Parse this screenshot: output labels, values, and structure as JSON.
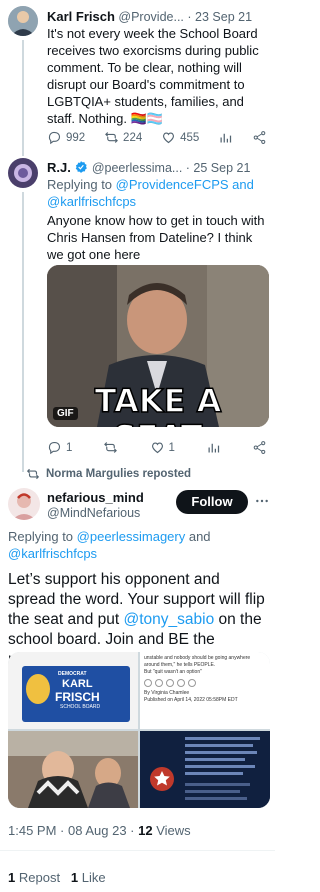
{
  "tweet1": {
    "name": "Karl Frisch",
    "handle": "@Provide...",
    "date": "· 23 Sep 21",
    "text": "It's not every week the School Board receives two exorcisms during public comment. To be clear, nothing will disrupt our Board's commitment to LGBTQIA+ students, families, and staff. Nothing. 🏳️‍🌈🏳️‍⚧️",
    "replies": "992",
    "retweets": "224",
    "likes": "455"
  },
  "tweet2": {
    "name": "R.J.",
    "handle": "@peerlessima...",
    "date": "· 25 Sep 21",
    "replying_prefix": "Replying to ",
    "replying_to_1": "@ProvidenceFCPS",
    "replying_and": " and",
    "replying_to_2": "@karlfrischfcps",
    "text": "Anyone know how to get in touch with Chris Hansen from Dateline? I think we got one here",
    "gif_caption": "TAKE A SEAT",
    "gif_badge": "GIF",
    "replies": "1",
    "likes": "1"
  },
  "repost": {
    "label": "Norma Margulies reposted"
  },
  "main": {
    "name": "nefarious_mind",
    "handle": "@MindNefarious",
    "follow_label": "Follow",
    "replying_prefix": "Replying to ",
    "replying_to_1": "@peerlessimagery",
    "replying_and": " and",
    "replying_to_2": "@karlfrischfcps",
    "text_before": "Let’s support his opponent and spread the word. Your support will flip the seat and put ",
    "mention": "@tony_sabio",
    "text_after": " on the school board. Join and BE the movement!",
    "collage": {
      "sign_line1": "DEMOCRAT",
      "sign_line2": "KARL",
      "sign_line3": "FRISCH",
      "sign_line4": "SCHOOL BOARD",
      "byline": "By Virginia Chamlee",
      "dateline": "Published on April 14, 2022 05:58PM EDT",
      "quote": "unstable and nobody should be going anywhere around them,\" he tells PEOPLE.",
      "quote2": "But \"quit wasn't an option\""
    },
    "meta_time": "1:45 PM",
    "meta_date": "· 08 Aug 23 ·",
    "meta_views_count": "12",
    "meta_views_label": "Views",
    "reposts_count": "1",
    "reposts_label": "Repost",
    "likes_count": "1",
    "likes_label": "Like"
  }
}
